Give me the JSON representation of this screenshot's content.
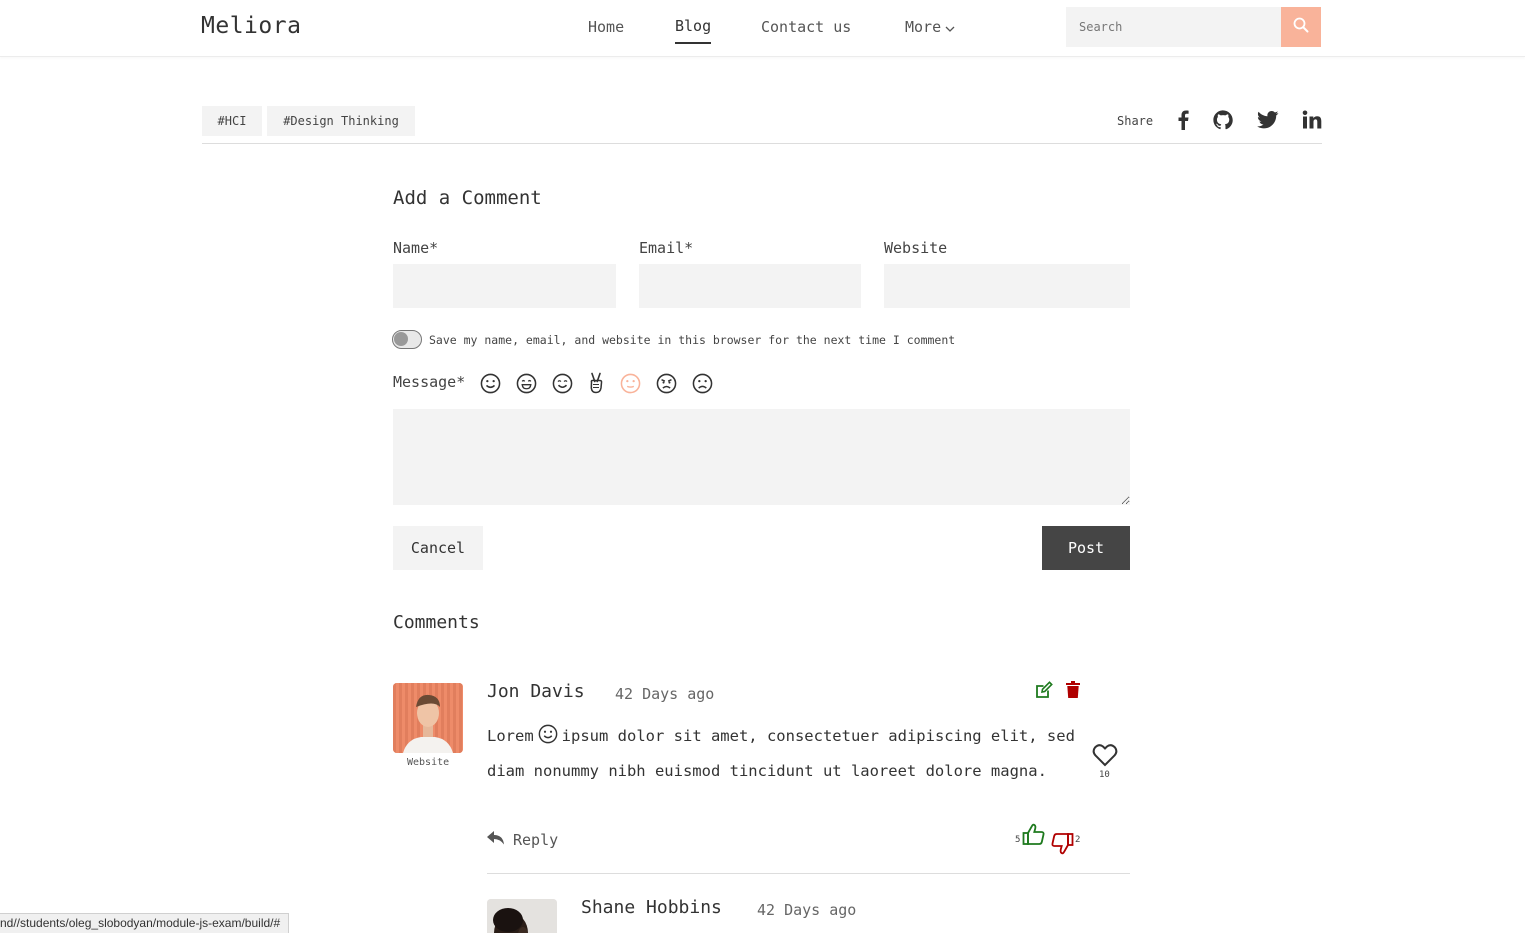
{
  "header": {
    "logo": "Meliora",
    "nav": [
      {
        "label": "Home"
      },
      {
        "label": "Blog"
      },
      {
        "label": "Contact us"
      },
      {
        "label": "More"
      }
    ],
    "search_placeholder": "Search",
    "search_icon": "search-icon",
    "accent_color": "#f9b39a"
  },
  "tags": [
    "#HCI",
    "#Design Thinking"
  ],
  "share": {
    "label": "Share",
    "icons": [
      "facebook-icon",
      "github-icon",
      "twitter-icon",
      "linkedin-icon"
    ]
  },
  "form": {
    "title": "Add a Comment",
    "name_label": "Name*",
    "email_label": "Email*",
    "website_label": "Website",
    "name_value": "",
    "email_value": "",
    "website_value": "",
    "save_toggle_text": "Save my name, email, and website in this browser for the next time I comment",
    "save_toggle_on": false,
    "message_label": "Message*",
    "message_value": "",
    "emojis": [
      "smile-icon",
      "grin-icon",
      "happy-icon",
      "peace-hand-icon",
      "neutral-face-icon",
      "angry-face-icon",
      "sad-face-icon"
    ],
    "selected_emoji_color": "#f9b39a",
    "cancel_label": "Cancel",
    "post_label": "Post"
  },
  "comments": {
    "title": "Comments",
    "items": [
      {
        "author": "Jon Davis",
        "time": "42 Days ago",
        "avatar_link": "Website",
        "body_before_emoji": "Lorem",
        "body_after_emoji": "ipsum dolor sit amet, consectetuer adipiscing elit, sed diam nonummy nibh euismod tincidunt ut laoreet dolore magna.",
        "likes": "10",
        "upvotes": "5",
        "downvotes": "2",
        "reply_label": "Reply",
        "edit_color": "#1e7a1e",
        "delete_color": "#b00000"
      },
      {
        "author": "Shane Hobbins",
        "time": "42 Days ago"
      }
    ]
  },
  "status_bar": "nd//students/oleg_slobodyan/module-js-exam/build/#"
}
